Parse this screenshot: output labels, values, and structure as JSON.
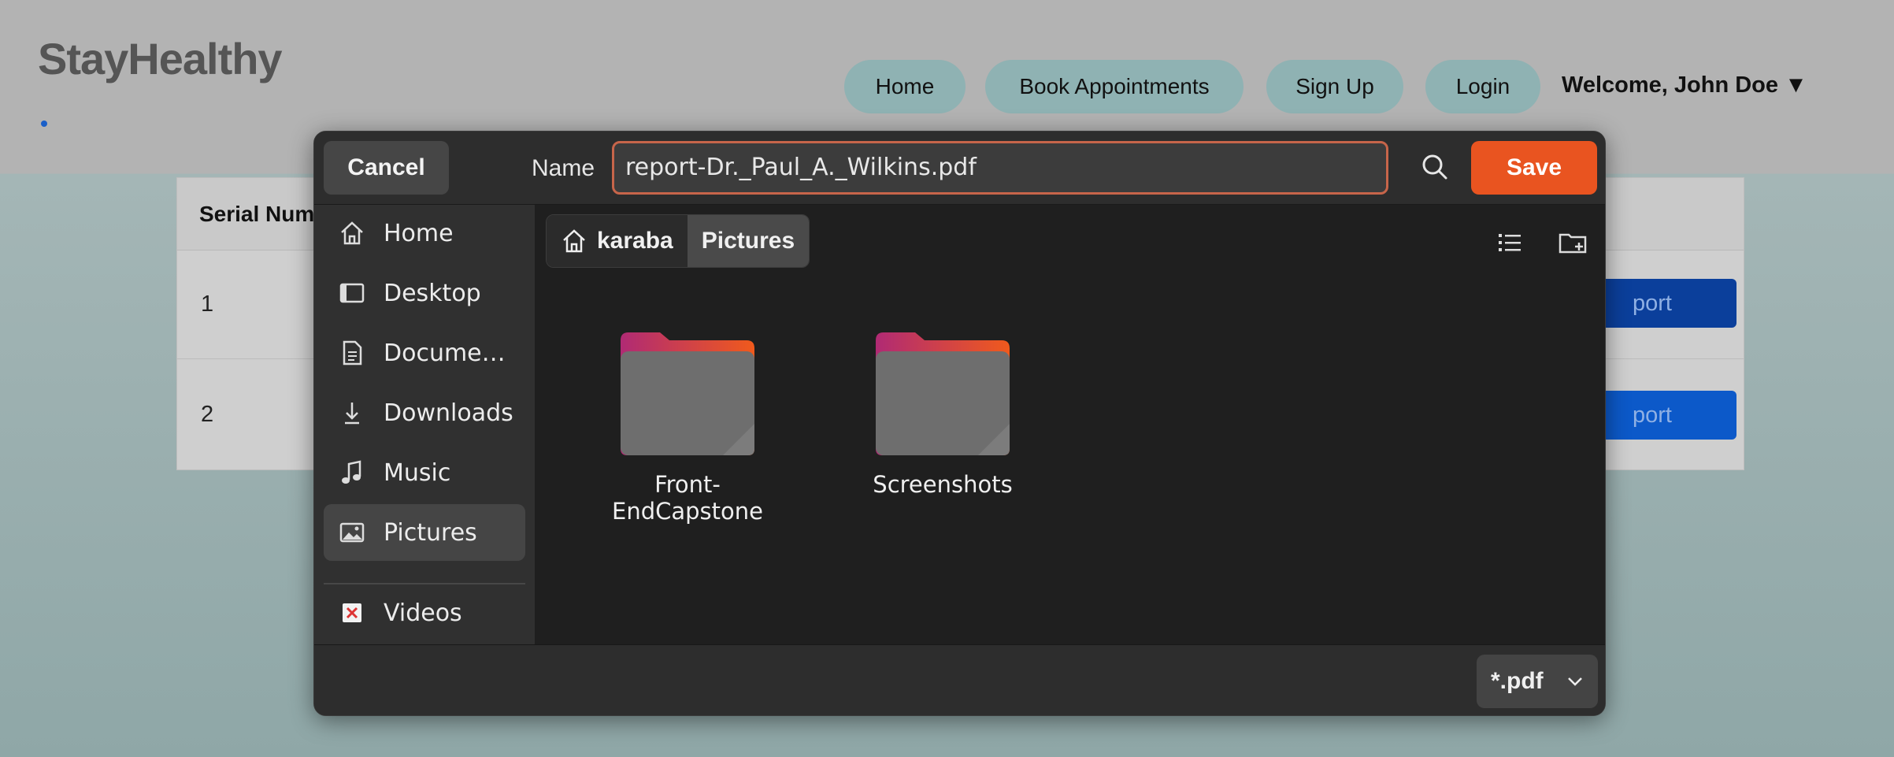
{
  "site": {
    "brand": "StayHealthy",
    "nav": [
      {
        "label": "Home"
      },
      {
        "label": "Book Appointments"
      },
      {
        "label": "Sign Up"
      },
      {
        "label": "Login"
      }
    ],
    "welcome": "Welcome, John Doe ▼"
  },
  "table": {
    "header_serial": "Serial Numb",
    "rows": [
      {
        "num": "1",
        "action": "port"
      },
      {
        "num": "2",
        "action": "port"
      }
    ]
  },
  "dialog": {
    "cancel_label": "Cancel",
    "name_label": "Name",
    "filename": "report-Dr._Paul_A._Wilkins.pdf",
    "save_label": "Save",
    "sidebar": [
      {
        "label": "Home",
        "icon": "home-icon"
      },
      {
        "label": "Desktop",
        "icon": "desktop-icon"
      },
      {
        "label": "Docume…",
        "icon": "document-icon"
      },
      {
        "label": "Downloads",
        "icon": "download-icon"
      },
      {
        "label": "Music",
        "icon": "music-icon"
      },
      {
        "label": "Pictures",
        "icon": "pictures-icon",
        "active": true
      },
      {
        "label": "Videos",
        "icon": "videos-icon"
      }
    ],
    "breadcrumb": [
      "karaba",
      "Pictures"
    ],
    "folders": [
      "Front-EndCapstone",
      "Screenshots"
    ],
    "filter": "*.pdf"
  },
  "colors": {
    "accent": "#e95420",
    "input_border": "#c7654a",
    "dialog_bg": "#1f1f1f",
    "nav_pill": "#8fb2b3"
  }
}
